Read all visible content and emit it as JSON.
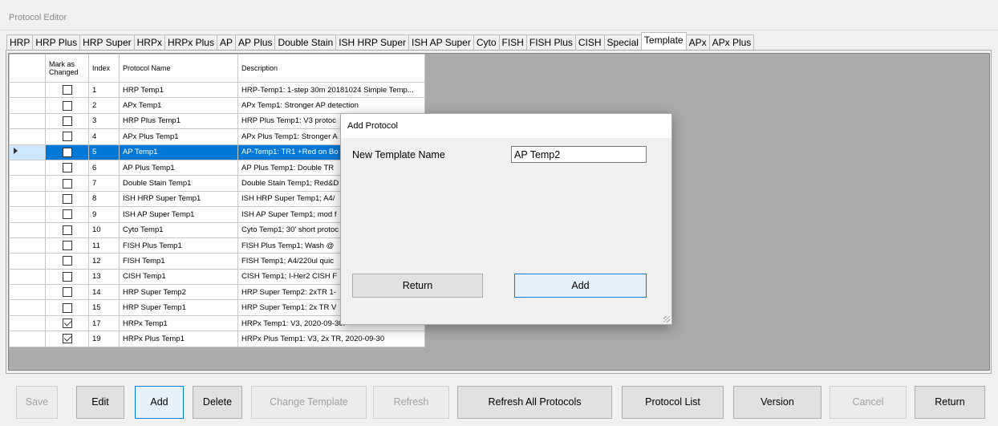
{
  "window": {
    "title": "Protocol Editor"
  },
  "tabs": [
    "HRP",
    "HRP Plus",
    "HRP Super",
    "HRPx",
    "HRPx Plus",
    "AP",
    "AP Plus",
    "Double Stain",
    "ISH HRP Super",
    "ISH AP Super",
    "Cyto",
    "FISH",
    "FISH Plus",
    "CISH",
    "Special",
    "Template",
    "APx",
    "APx Plus"
  ],
  "active_tab": "Template",
  "grid": {
    "headers": {
      "mark": "Mark as Changed",
      "index": "Index",
      "name": "Protocol Name",
      "desc": "Description"
    },
    "rows": [
      {
        "checked": false,
        "index": "1",
        "name": "HRP Temp1",
        "desc": "HRP-Temp1: 1-step 30m 20181024 Simple Temp..."
      },
      {
        "checked": false,
        "index": "2",
        "name": "APx Temp1",
        "desc": "APx Temp1: Stronger AP detection"
      },
      {
        "checked": false,
        "index": "3",
        "name": "HRP Plus Temp1",
        "desc": "HRP Plus Temp1: V3 protoc"
      },
      {
        "checked": false,
        "index": "4",
        "name": "APx Plus Temp1",
        "desc": "APx Plus Temp1: Stronger A"
      },
      {
        "checked": false,
        "index": "5",
        "name": "AP Temp1",
        "desc": "AP-Temp1: TR1 +Red on Bo",
        "selected": true
      },
      {
        "checked": false,
        "index": "6",
        "name": "AP Plus Temp1",
        "desc": "AP Plus Temp1: Double TR"
      },
      {
        "checked": false,
        "index": "7",
        "name": "Double Stain Temp1",
        "desc": "Double Stain Temp1; Red&D"
      },
      {
        "checked": false,
        "index": "8",
        "name": "ISH HRP Super Temp1",
        "desc": "ISH HRP Super Temp1; A4/"
      },
      {
        "checked": false,
        "index": "9",
        "name": "ISH AP Super Temp1",
        "desc": "ISH AP Super Temp1; mod f"
      },
      {
        "checked": false,
        "index": "10",
        "name": "Cyto Temp1",
        "desc": "Cyto Temp1; 30' short protoc"
      },
      {
        "checked": false,
        "index": "11",
        "name": "FISH Plus Temp1",
        "desc": "FISH Plus Temp1; Wash @"
      },
      {
        "checked": false,
        "index": "12",
        "name": "FISH Temp1",
        "desc": "FISH Temp1; A4/220ul quic"
      },
      {
        "checked": false,
        "index": "13",
        "name": "CISH Temp1",
        "desc": "CISH Temp1; I-Her2 CISH F"
      },
      {
        "checked": false,
        "index": "14",
        "name": "HRP Super Temp2",
        "desc": "HRP Super Temp2: 2xTR 1-"
      },
      {
        "checked": false,
        "index": "15",
        "name": "HRP Super Temp1",
        "desc": "HRP Super Temp1: 2x TR V"
      },
      {
        "checked": true,
        "index": "17",
        "name": "HRPx Temp1",
        "desc": "HRPx Temp1: V3, 2020-09-30."
      },
      {
        "checked": true,
        "index": "19",
        "name": "HRPx Plus Temp1",
        "desc": "HRPx Plus Temp1: V3, 2x TR, 2020-09-30"
      }
    ]
  },
  "dialog": {
    "title": "Add Protocol",
    "label": "New Template Name",
    "value": "AP Temp2",
    "return_label": "Return",
    "add_label": "Add"
  },
  "buttons": {
    "save": "Save",
    "edit": "Edit",
    "add": "Add",
    "delete": "Delete",
    "change_template": "Change Template",
    "refresh": "Refresh",
    "refresh_all": "Refresh All Protocols",
    "protocol_list": "Protocol List",
    "version": "Version",
    "cancel": "Cancel",
    "return": "Return"
  },
  "colors": {
    "selection": "#0078d7",
    "focus_border": "#0078d7"
  }
}
